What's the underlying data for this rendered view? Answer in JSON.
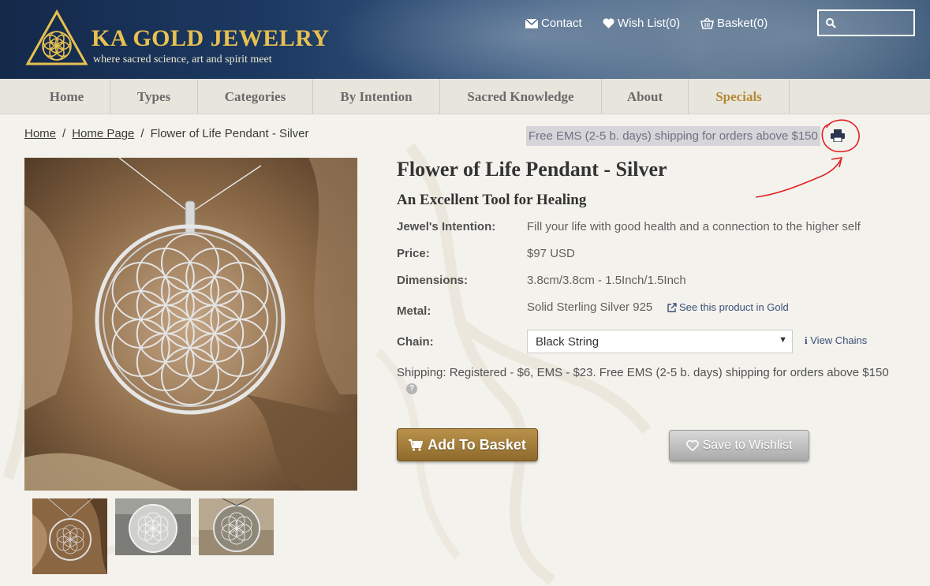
{
  "brand": {
    "title": "KA GOLD JEWELRY",
    "tagline": "where sacred science, art and spirit meet",
    "gold_color": "#e8c050"
  },
  "top_links": {
    "contact": "Contact",
    "wishlist": "Wish List(0)",
    "basket": "Basket(0)"
  },
  "search": {
    "placeholder": ""
  },
  "nav": {
    "items": [
      "Home",
      "Types",
      "Categories",
      "By Intention",
      "Sacred Knowledge",
      "About",
      "Specials"
    ],
    "specials_color": "#b58a32"
  },
  "breadcrumb": {
    "home": "Home",
    "home_page": "Home Page",
    "current": "Flower of Life Pendant - Silver",
    "separator": "/"
  },
  "shipping_banner": "Free EMS (2-5 b. days) shipping for orders above $150",
  "icons": {
    "print": "print-icon",
    "search": "search-icon",
    "contact": "envelope-icon",
    "wishlist": "heart-icon",
    "basket": "basket-icon",
    "cart": "cart-icon",
    "external": "external-link-icon",
    "info": "info-icon",
    "help": "question-icon"
  },
  "product": {
    "title": "Flower of Life Pendant - Silver",
    "subtitle": "An Excellent Tool for Healing",
    "specs": {
      "intention_label": "Jewel's Intention:",
      "intention_value": "Fill your life with good health and a connection to the higher self",
      "price_label": "Price:",
      "price_value": "$97 USD",
      "dimensions_label": "Dimensions:",
      "dimensions_value": "3.8cm/3.8cm -  1.5Inch/1.5Inch",
      "metal_label": "Metal:",
      "metal_value": "Solid Sterling Silver 925",
      "gold_link": "See this product in Gold",
      "chain_label": "Chain:",
      "chain_selected": "Black String",
      "view_chains": "View Chains"
    },
    "shipping_text": "Shipping: Registered - $6, EMS - $23.  Free EMS (2-5 b. days) shipping for orders above $150",
    "help_glyph": "?",
    "add_to_basket": "Add To Basket",
    "save_to_wishlist": "Save to Wishlist",
    "basket_button_color": "#a07c3a"
  }
}
